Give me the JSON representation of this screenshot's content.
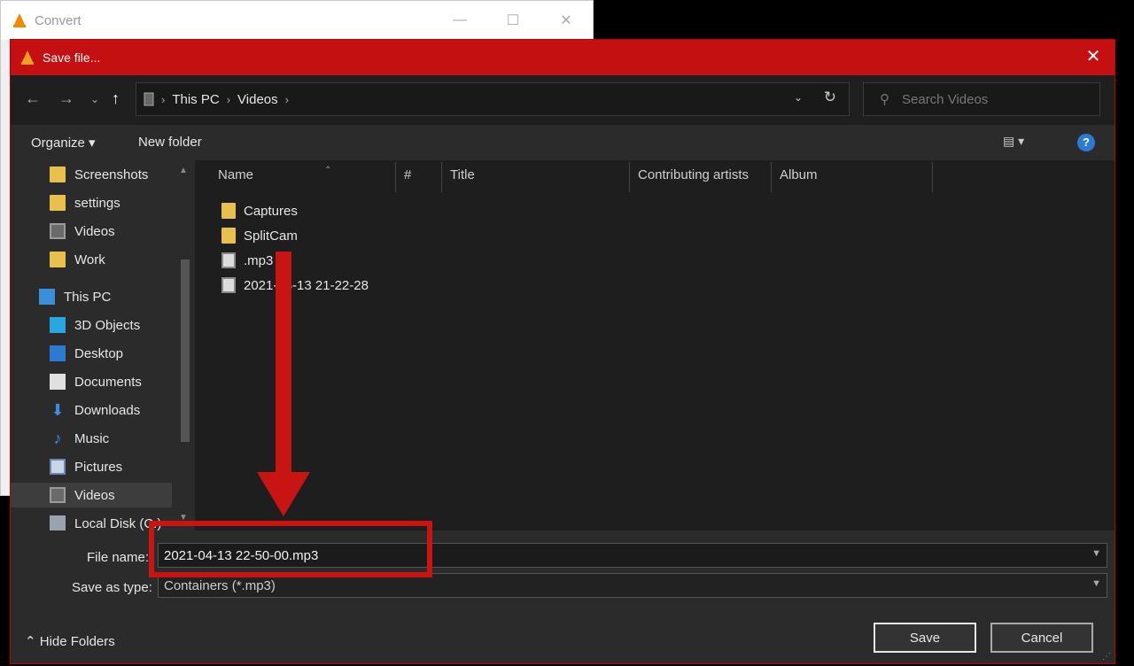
{
  "background_window": {
    "title": "Convert",
    "minimize": "—",
    "maximize": "☐",
    "close": "✕"
  },
  "dialog": {
    "title": "Save file...",
    "close": "✕",
    "nav": {
      "back": "←",
      "forward": "→",
      "recent": "⌄",
      "up": "↑"
    },
    "address": {
      "crumbs": [
        "This PC",
        "Videos"
      ],
      "sep": "›",
      "dropdown": "⌄",
      "refresh": "↻"
    },
    "search": {
      "placeholder": "Search Videos",
      "icon": "⚲"
    },
    "toolbar": {
      "organize": "Organize ▾",
      "new_folder": "New folder",
      "view": "▤ ▾",
      "help": "?"
    },
    "nav_pane": [
      {
        "label": "Screenshots",
        "icon": "folder-icon"
      },
      {
        "label": "settings",
        "icon": "folder-icon"
      },
      {
        "label": "Videos",
        "icon": "video-folder-icon"
      },
      {
        "label": "Work",
        "icon": "folder-icon"
      },
      {
        "label": "This PC",
        "icon": "pc-icon"
      },
      {
        "label": "3D Objects",
        "icon": "3d-objects-icon"
      },
      {
        "label": "Desktop",
        "icon": "desktop-icon"
      },
      {
        "label": "Documents",
        "icon": "documents-icon"
      },
      {
        "label": "Downloads",
        "icon": "downloads-icon"
      },
      {
        "label": "Music",
        "icon": "music-icon"
      },
      {
        "label": "Pictures",
        "icon": "pictures-icon"
      },
      {
        "label": "Videos",
        "icon": "video-folder-icon",
        "selected": true
      },
      {
        "label": "Local Disk (C:)",
        "icon": "disk-icon"
      }
    ],
    "columns": [
      "Name",
      "#",
      "Title",
      "Contributing artists",
      "Album"
    ],
    "files": [
      {
        "name": "Captures",
        "type": "folder"
      },
      {
        "name": "SplitCam",
        "type": "folder"
      },
      {
        "name": ".mp3",
        "type": "mp3"
      },
      {
        "name": "2021-04-13 21-22-28",
        "type": "mp3"
      }
    ],
    "file_name_label": "File name:",
    "file_name_value": "2021-04-13 22-50-00.mp3",
    "save_as_type_label": "Save as type:",
    "save_as_type_value": "Containers (*.mp3)",
    "hide_folders": "⌃ Hide Folders",
    "save_button": "Save",
    "cancel_button": "Cancel",
    "accent_color": "#c41010",
    "annotation_color": "#c91414"
  }
}
